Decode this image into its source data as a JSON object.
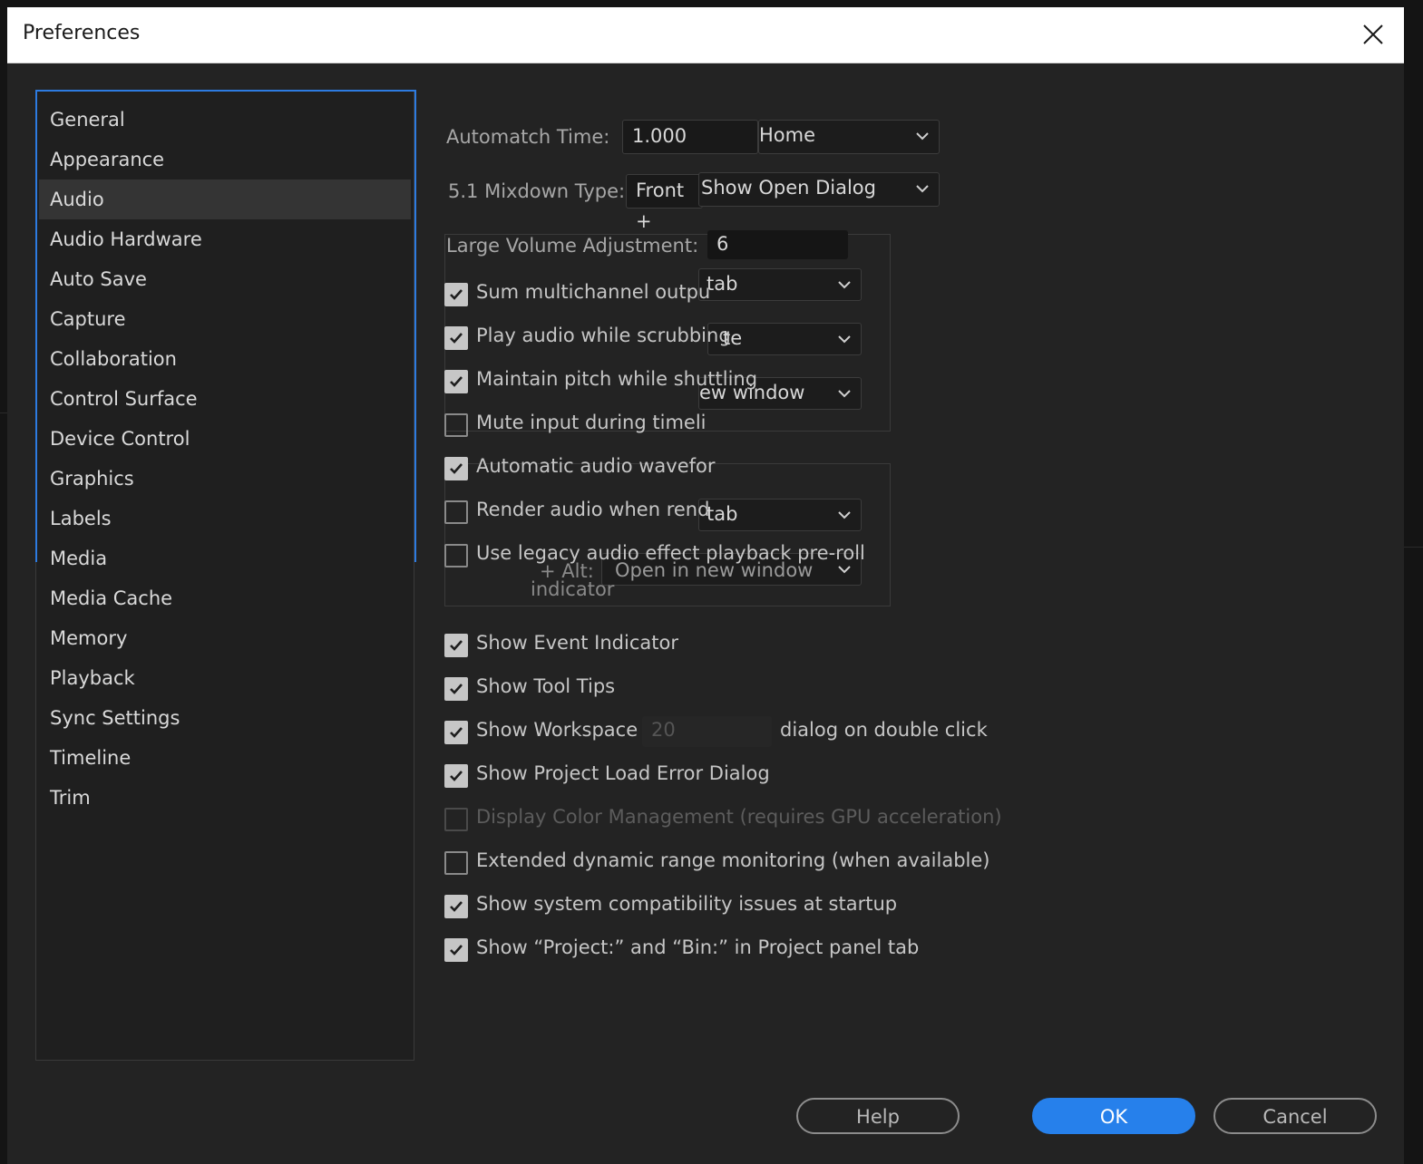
{
  "window": {
    "title": "Preferences"
  },
  "sidebar": {
    "items": [
      {
        "label": "General"
      },
      {
        "label": "Appearance"
      },
      {
        "label": "Audio",
        "selected": true
      },
      {
        "label": "Audio Hardware"
      },
      {
        "label": "Auto Save"
      },
      {
        "label": "Capture"
      },
      {
        "label": "Collaboration"
      },
      {
        "label": "Control Surface"
      },
      {
        "label": "Device Control"
      },
      {
        "label": "Graphics"
      },
      {
        "label": "Labels"
      },
      {
        "label": "Media"
      },
      {
        "label": "Media Cache"
      },
      {
        "label": "Memory"
      },
      {
        "label": "Playback"
      },
      {
        "label": "Sync Settings"
      },
      {
        "label": "Timeline"
      },
      {
        "label": "Trim"
      }
    ]
  },
  "audio": {
    "automatch_label": "Automatch Time:",
    "automatch_value": "1.000",
    "mixdown_label": "5.1 Mixdown Type:",
    "mixdown_value": "Front +",
    "large_volume_label": "Large Volume Adjustment:",
    "large_volume_value": "6"
  },
  "ghost": {
    "home_select": "Home",
    "open_dialog_select": "Show Open Dialog",
    "tab_select_1": "tab",
    "te_select": "te",
    "new_window_1": "ew window",
    "tab_select_2": "tab",
    "new_window_2": "Open in new window",
    "alt_text": "+ Alt:",
    "indicator_text": "indicator",
    "recent_value": "20",
    "hidden_fragment": "Show Workspace R"
  },
  "checkboxes": [
    {
      "label": "Sum multichannel outpu",
      "checked": true
    },
    {
      "label": "Play audio while scrubbing",
      "checked": true
    },
    {
      "label": "Maintain pitch while shuttling",
      "checked": true
    },
    {
      "label": "Mute input during timeli",
      "checked": false
    },
    {
      "label": "Automatic audio wavefor",
      "checked": true
    },
    {
      "label": "Render audio when rend",
      "checked": false
    },
    {
      "label": "Use legacy audio effect playback pre-roll",
      "checked": false
    }
  ],
  "general_checkboxes": [
    {
      "label": "Show Event Indicator",
      "checked": true
    },
    {
      "label": "Show Tool Tips",
      "checked": true
    },
    {
      "label": "Show Workspace F",
      "suffix": "dialog on double click",
      "checked": true
    },
    {
      "label": "Show Project Load Error Dialog",
      "checked": true
    },
    {
      "label": "Display Color Management (requires GPU acceleration)",
      "checked": false,
      "disabled": true
    },
    {
      "label": "Extended dynamic range monitoring (when available)",
      "checked": false
    },
    {
      "label": "Show system compatibility issues at startup",
      "checked": true
    },
    {
      "label": "Show “Project:” and “Bin:” in Project panel tab",
      "checked": true
    }
  ],
  "buttons": {
    "help": "Help",
    "ok": "OK",
    "cancel": "Cancel"
  },
  "colors": {
    "accent": "#2680eb",
    "background": "#232323",
    "titlebar": "#ffffff"
  }
}
